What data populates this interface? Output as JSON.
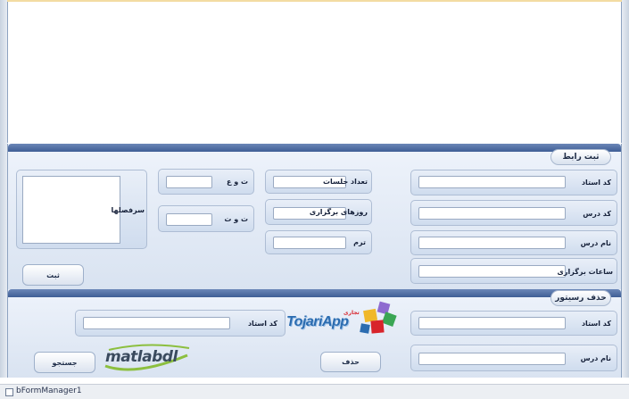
{
  "form1": {
    "title": "ثبت رابط",
    "labels": {
      "teacher_code": "کد استاد",
      "course_code": "کد درس",
      "course_name": "نام درس",
      "hours": "ساعات برگزاری",
      "sessions": "تعداد جلسات",
      "days": "روزهای برگزاری",
      "term": "ترم",
      "t_w": "ت و ع",
      "t_v": "ت و ت",
      "syllabus": "سرفصلها"
    },
    "submit_label": "ثبت"
  },
  "form2": {
    "title": "حذف رسیتور",
    "labels": {
      "teacher_code_right": "کد استاد",
      "teacher_code_left": "کد استاد",
      "course_name": "نام درس"
    },
    "delete_label": "حذف",
    "search_label": "جستجو"
  },
  "logos": {
    "tojari_text": "TojariApp",
    "tojari_sup": "تجاری",
    "matlab_text": "matlabdl"
  },
  "status": {
    "text": "bFormManager1"
  },
  "colors": {
    "bar": "#3f5e95",
    "panel": "#dfe7f3",
    "logo_red": "#d8242b",
    "logo_blue": "#2b6cb0",
    "matlab_green": "#8cbf3f"
  }
}
